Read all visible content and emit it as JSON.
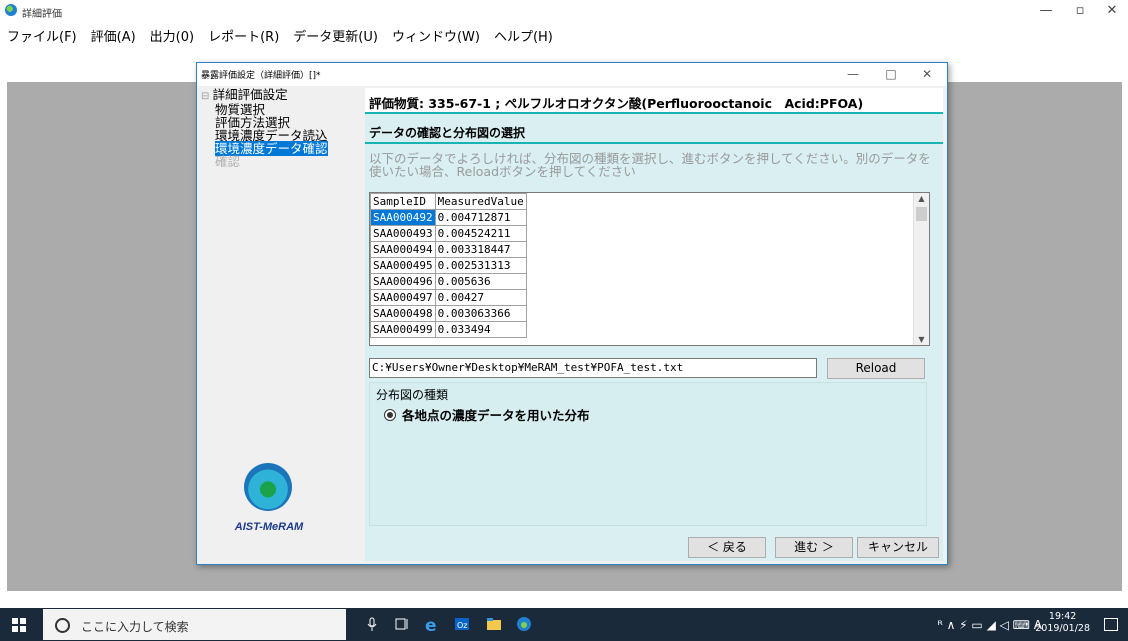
{
  "app": {
    "title": "詳細評価",
    "minimize": "—",
    "restore": "▫",
    "close": "✕"
  },
  "menu": [
    "ファイル(F)",
    "評価(A)",
    "出力(0)",
    "レポート(R)",
    "データ更新(U)",
    "ウィンドウ(W)",
    "ヘルプ(H)"
  ],
  "toolbar_icons": [
    "folder-icon",
    "chart-icon",
    "sequence-icon",
    "pdf-icon",
    "print-icon",
    "window-icon",
    "save-icon",
    "record-icon",
    "delete-icon"
  ],
  "dialog": {
    "title": "暴露評価設定（詳細評価）[]*",
    "minimize": "—",
    "maximize": "□",
    "close": "✕",
    "tree": {
      "root": "詳細評価設定",
      "items": [
        "物質選択",
        "評価方法選択",
        "環境濃度データ読込",
        "環境濃度データ確認",
        "確認"
      ]
    },
    "logo_text": "AIST-MeRAM",
    "substance": "評価物質: 335-67-1 ; ペルフルオロオクタン酸(Perfluorooctanoic　Acid:PFOA)",
    "section_title": "データの確認と分布図の選択",
    "instruction": "以下のデータでよろしければ、分布図の種類を選択し、進むボタンを押してください。別のデータを使いたい場合、Reloadボタンを押してください",
    "table": {
      "columns": [
        "SampleID",
        "MeasuredValue"
      ],
      "rows": [
        [
          "SAA000492",
          "0.004712871"
        ],
        [
          "SAA000493",
          "0.004524211"
        ],
        [
          "SAA000494",
          "0.003318447"
        ],
        [
          "SAA000495",
          "0.002531313"
        ],
        [
          "SAA000496",
          "0.005636"
        ],
        [
          "SAA000497",
          "0.00427"
        ],
        [
          "SAA000498",
          "0.003063366"
        ],
        [
          "SAA000499",
          "0.033494"
        ]
      ]
    },
    "file_path": "C:¥Users¥Owner¥Desktop¥MeRAM_test¥POFA_test.txt",
    "reload_label": "Reload",
    "distribution_label": "分布図の種類",
    "distribution_option": "各地点の濃度データを用いた分布",
    "back_label": "＜ 戻る",
    "next_label": "進む ＞",
    "cancel_label": "キャンセル"
  },
  "taskbar": {
    "search_placeholder": "ここに入力して検索",
    "tray_text": "ᴿ ∧ ⚡ ▭ ◢ ◁ ⌨ A",
    "time": "19:42",
    "date": "2019/01/28"
  }
}
